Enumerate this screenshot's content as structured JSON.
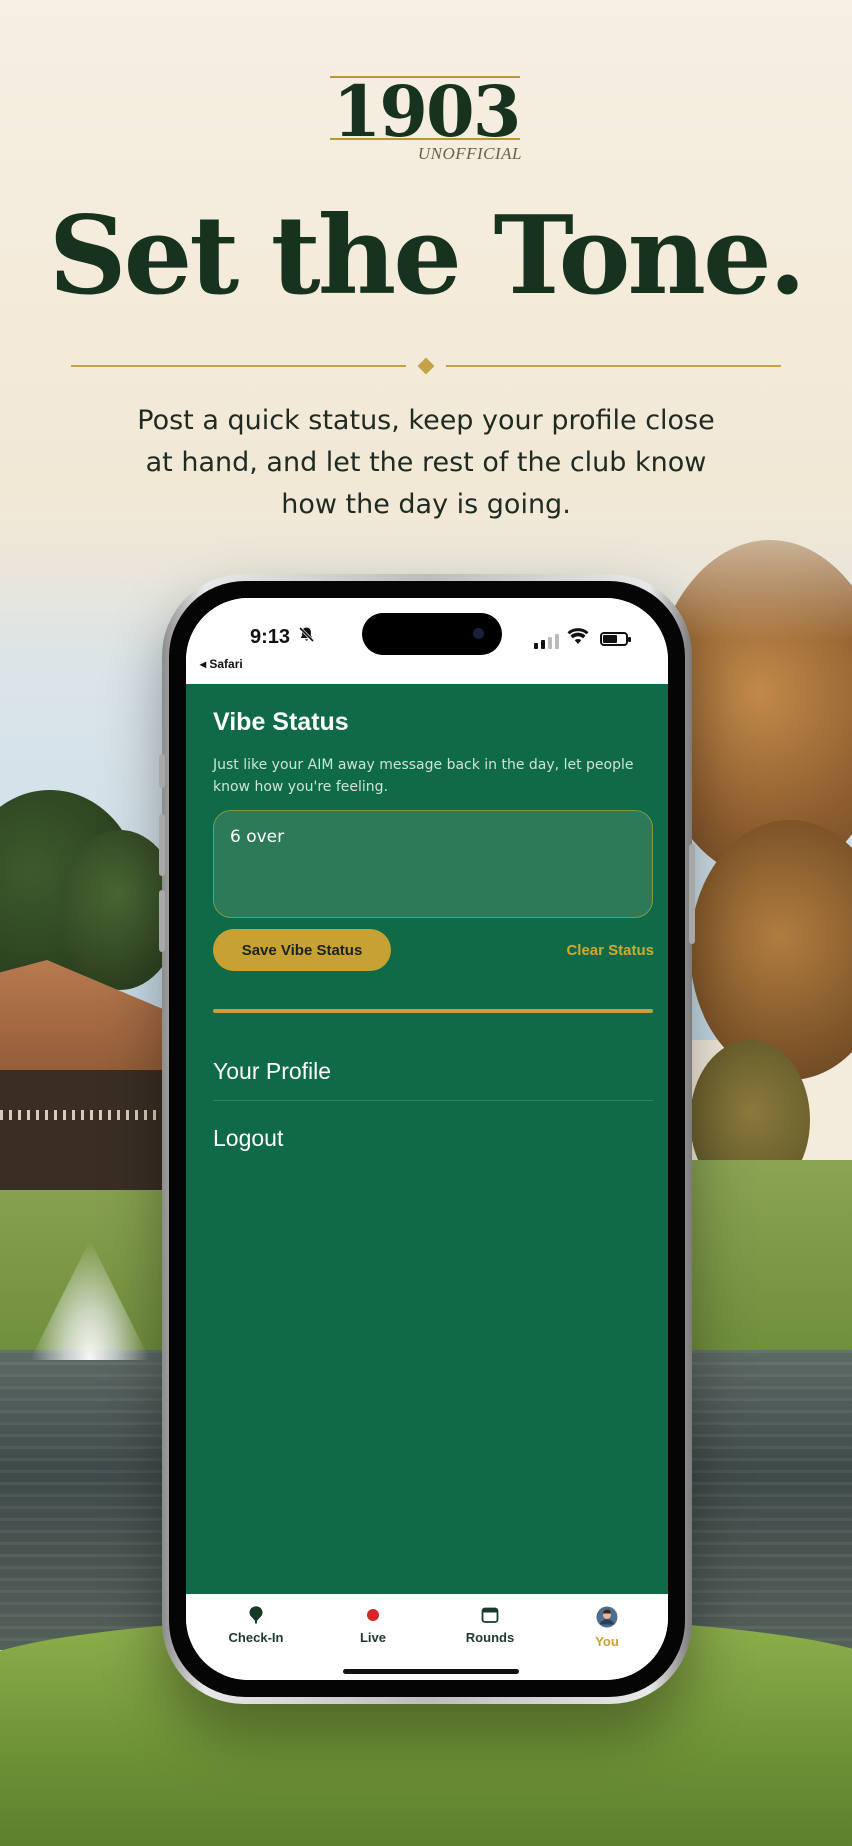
{
  "brand": {
    "logo_text": "1903",
    "logo_subtext": "UNOFFICIAL"
  },
  "hero": {
    "headline": "Set the Tone.",
    "subtitle": "Post a quick status, keep your profile close at hand, and let the rest of the club know how the day is going."
  },
  "phone": {
    "status_bar": {
      "time": "9:13",
      "back_app": "◂ Safari"
    },
    "vibe": {
      "title": "Vibe Status",
      "description": "Just like your AIM away message back in the day, let people know how you're feeling.",
      "input_value": "6 over",
      "save_label": "Save Vibe Status",
      "clear_label": "Clear Status"
    },
    "menu": {
      "profile_label": "Your Profile",
      "logout_label": "Logout"
    },
    "tabs": [
      {
        "label": "Check-In",
        "icon": "golf-ball-tee-icon"
      },
      {
        "label": "Live",
        "icon": "live-dot-icon"
      },
      {
        "label": "Rounds",
        "icon": "calendar-icon"
      },
      {
        "label": "You",
        "icon": "avatar-icon",
        "active": true
      }
    ]
  },
  "colors": {
    "app_green": "#0f6a47",
    "gold": "#c7a133",
    "headline_green": "#17331f",
    "cream": "#f3ebdc"
  }
}
